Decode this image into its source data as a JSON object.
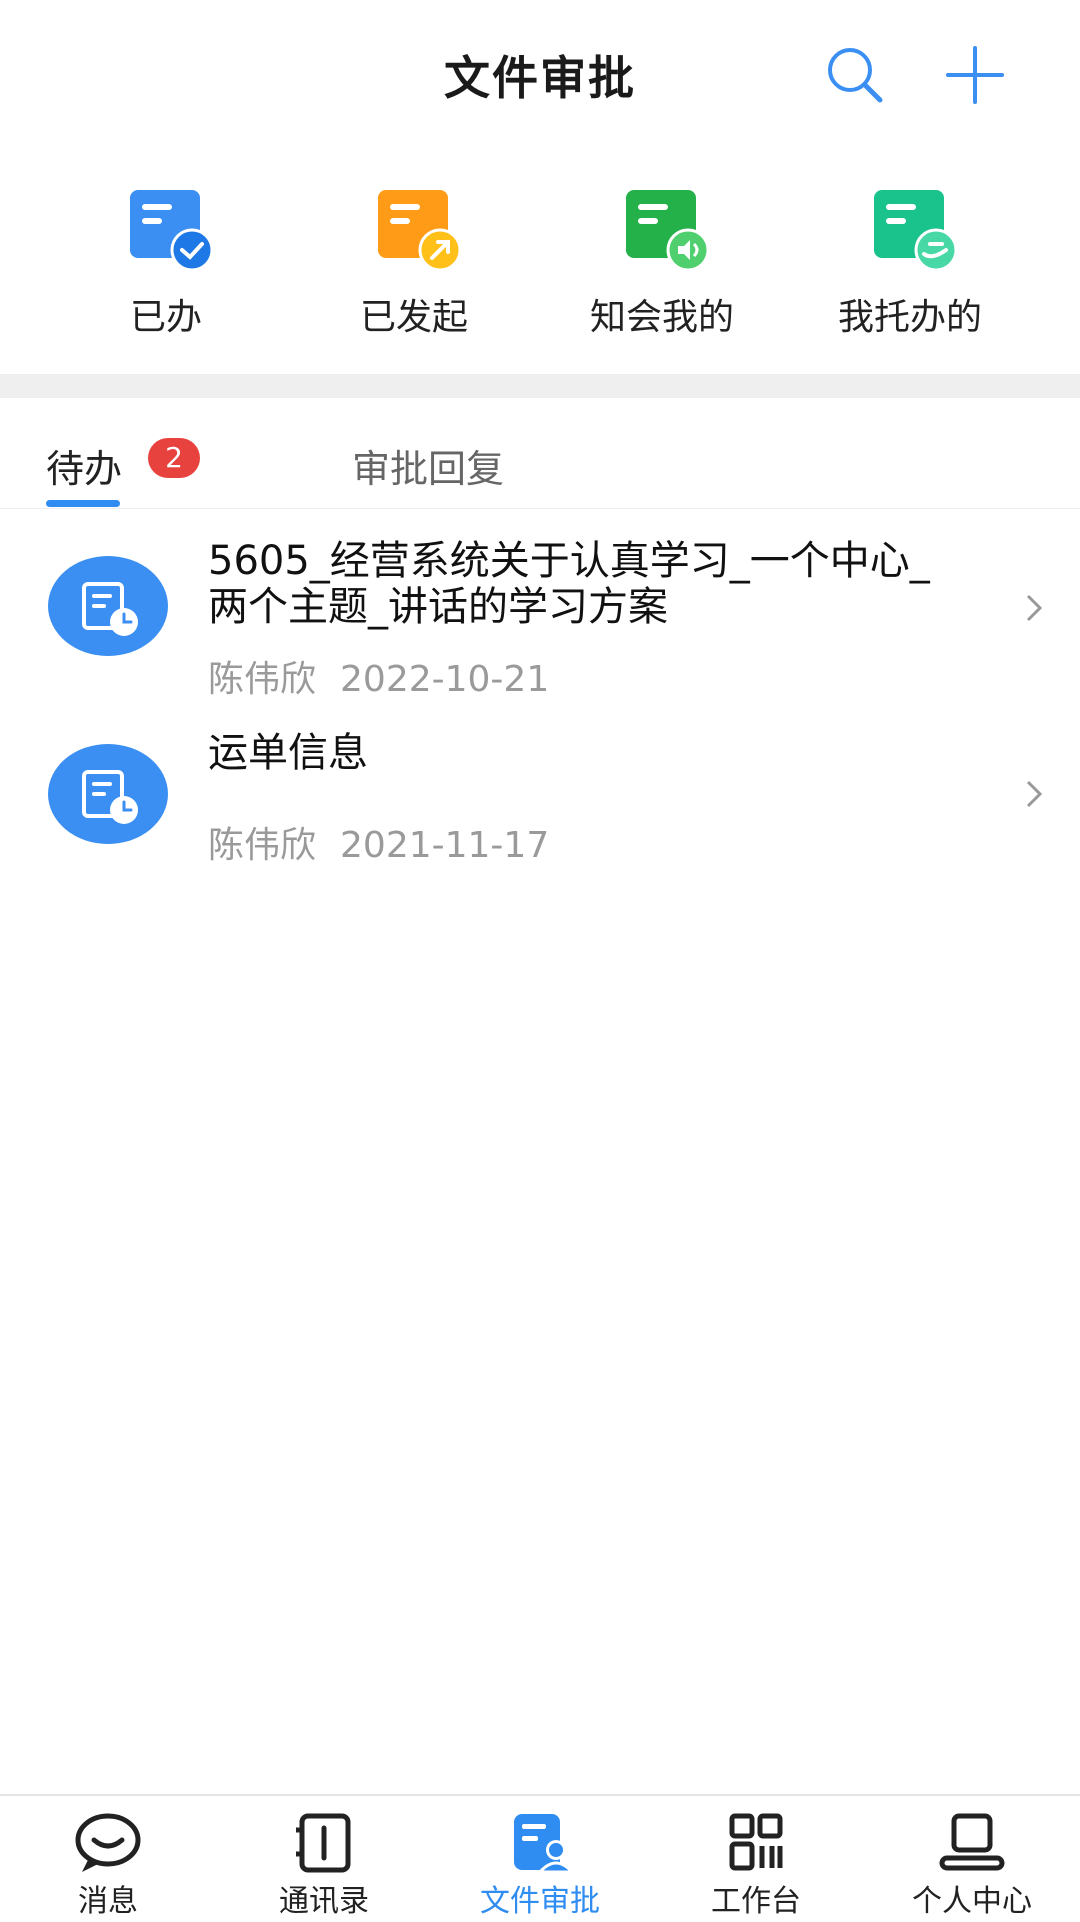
{
  "header": {
    "title": "文件审批",
    "search_icon": "search-icon",
    "add_icon": "plus-icon"
  },
  "quick_actions": [
    {
      "label": "已办",
      "icon": "done-doc-icon",
      "color": "#3b8ff3"
    },
    {
      "label": "已发起",
      "icon": "initiated-doc-icon",
      "color": "#ff9b16"
    },
    {
      "label": "知会我的",
      "icon": "notify-doc-icon",
      "color": "#25b14a"
    },
    {
      "label": "我托办的",
      "icon": "delegated-doc-icon",
      "color": "#1bc38c"
    }
  ],
  "tabs": {
    "todo": "待办",
    "todo_badge": "2",
    "reply": "审批回复"
  },
  "items": [
    {
      "title": "5605_经营系统关于认真学习_一个中心_两个主题_讲话的学习方案",
      "author": "陈伟欣",
      "date": "2022-10-21"
    },
    {
      "title": "运单信息",
      "author": "陈伟欣",
      "date": "2021-11-17"
    }
  ],
  "nav": [
    {
      "label": "消息",
      "icon": "message-icon"
    },
    {
      "label": "通讯录",
      "icon": "contacts-icon"
    },
    {
      "label": "文件审批",
      "icon": "file-approval-icon",
      "active": true
    },
    {
      "label": "工作台",
      "icon": "workbench-icon"
    },
    {
      "label": "个人中心",
      "icon": "profile-icon"
    }
  ],
  "colors": {
    "accent": "#2f8cf0",
    "badge": "#e8423f"
  }
}
